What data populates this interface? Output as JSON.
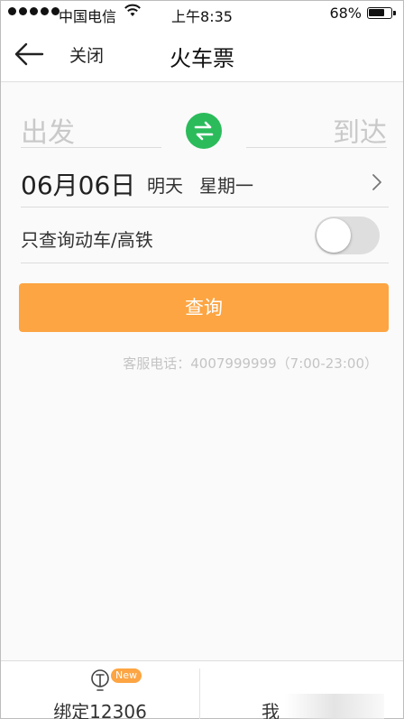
{
  "status_bar": {
    "carrier": "中国电信",
    "time": "上午8:35",
    "battery": "68%",
    "battery_level": 0.68
  },
  "nav": {
    "close_label": "关闭",
    "title": "火车票"
  },
  "form": {
    "from_placeholder": "出发",
    "to_placeholder": "到达",
    "date": "06月06日",
    "date_relative": "明天",
    "weekday": "星期一",
    "high_speed_label": "只查询动车/高铁",
    "high_speed_on": false,
    "query_label": "查询",
    "service_phone": "客服电话：4007999999（7:00-23:00）"
  },
  "tabbar": {
    "bind_label": "绑定12306",
    "bind_badge": "New",
    "me_label": "我"
  },
  "colors": {
    "accent": "#fca542",
    "swap_green": "#2bbb5b",
    "placeholder": "#c9c9c9"
  },
  "icons": [
    "wifi-icon",
    "battery-icon",
    "back-arrow-icon",
    "swap-icon",
    "chevron-right-icon",
    "train-icon"
  ]
}
